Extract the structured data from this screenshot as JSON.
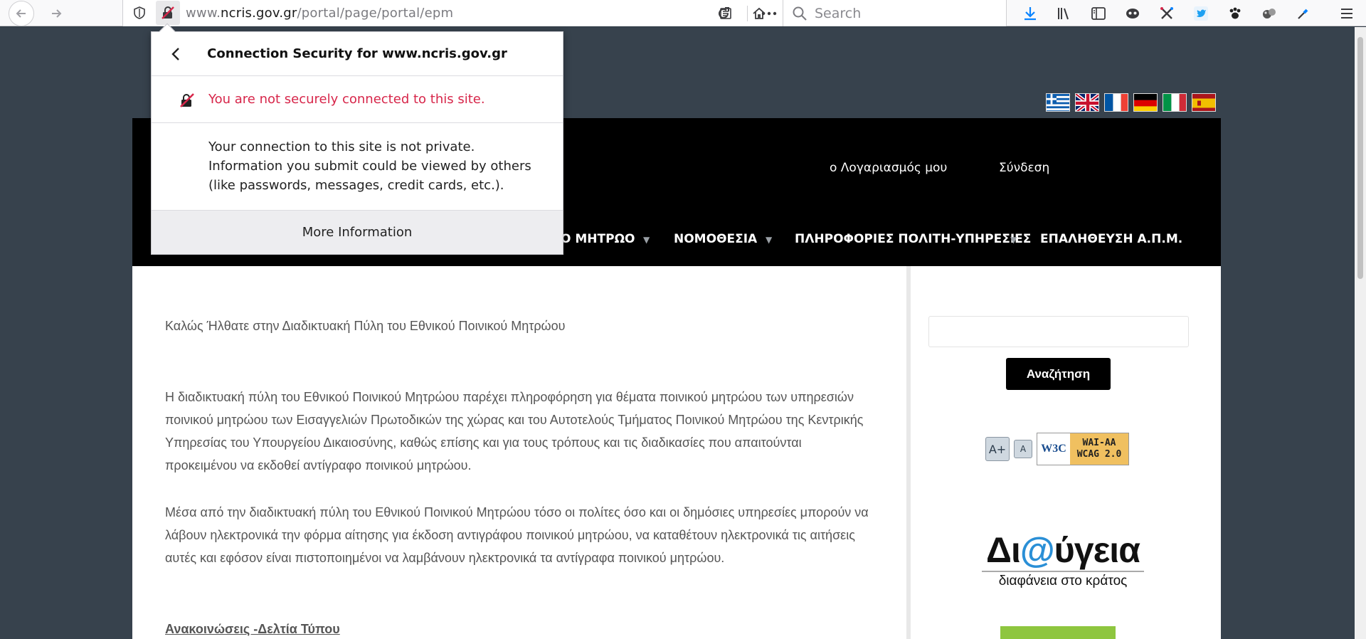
{
  "browser": {
    "url_prefix": "www.",
    "url_domain": "ncris.gov.gr",
    "url_path": "/portal/page/portal/epm",
    "search_placeholder": "Search",
    "icons": {
      "back": "back-arrow-icon",
      "forward": "forward-arrow-icon",
      "tracking": "tracking-shield-icon",
      "insecure": "insecure-lock-icon",
      "reader": "reader-view-icon",
      "more": "page-actions-icon",
      "pocket": "pocket-icon",
      "bookmark": "bookmark-star-icon",
      "reload": "reload-icon",
      "home": "home-icon",
      "search": "search-icon",
      "download": "download-arrow-icon",
      "library": "library-icon",
      "sidebar": "sidebar-icon",
      "menu": "hamburger-menu-icon"
    },
    "colors": {
      "download": "#0a84ff",
      "insecure": "#d7264a"
    }
  },
  "popup": {
    "title": "Connection Security for www.ncris.gov.gr",
    "warning": "You are not securely connected to this site.",
    "info": "Your connection to this site is not private. Information you submit could be viewed by others (like passwords, messages, credit cards, etc.).",
    "more_button": "More Information"
  },
  "site": {
    "header_links": {
      "account": "ο Λογαριασμός μου",
      "login": "Σύνδεση"
    },
    "nav": [
      {
        "label": "Ο ΜΗΤΡΩΟ"
      },
      {
        "label": "ΝΟΜΟΘΕΣΙΑ"
      },
      {
        "label": "ΠΛΗΡΟΦΟΡΙΕΣ ΠΟΛΙΤΗ-ΥΠΗΡΕΣΙΕΣ"
      },
      {
        "label": "ΕΠΑΛΗΘΕΥΣΗ Α.Π.Μ."
      }
    ],
    "flags": [
      "greek-flag-icon",
      "uk-flag-icon",
      "french-flag-icon",
      "german-flag-icon",
      "italian-flag-icon",
      "spanish-flag-icon"
    ],
    "welcome": "Καλώς Ήλθατε στην Διαδικτυακή Πύλη του Εθνικού Ποινικού Μητρώου",
    "para1": "Η διαδικτυακή πύλη του Εθνικού Ποινικού Μητρώου παρέχει πληροφόρηση για θέματα  ποινικού μητρώου των υπηρεσιών ποινικού μητρώου των Εισαγγελιών Πρωτοδικών της χώρας και του Αυτοτελούς Τμήματος Ποινικού Μητρώου της Κεντρικής Υπηρεσίας του Υπουργείου Δικαιοσύνης, καθώς επίσης και για τους τρόπους και τις διαδικασίες που απαιτούνται προκειμένου να εκδοθεί αντίγραφο ποινικού μητρώου.",
    "para2": "Μέσα από την διαδικτυακή πύλη του Εθνικού Ποινικού Μητρώου τόσο οι πολίτες όσο και οι δημόσιες υπηρεσίες μπορούν να λάβουν ηλεκτρονικά την φόρμα αίτησης για έκδοση αντιγράφου ποινικού μητρώου, να καταθέτουν ηλεκτρονικά τις αιτήσεις αυτές και εφόσον είναι πιστοποιημένοι να λαμβάνουν ηλεκτρονικά τα αντίγραφα ποινικού μητρώου.",
    "news_link": "Ανακοινώσεις -Δελτία Τύπου",
    "search_button": "Αναζήτηση",
    "a11y": {
      "increase": "A",
      "decrease": "A"
    },
    "w3c": {
      "logo": "W3C",
      "line1": "WAI-AA",
      "line2": "WCAG 2.0"
    },
    "diavgeia": {
      "part1": "Δι",
      "part2": "@",
      "part3": "ύγεια",
      "subtitle": "διαφάνεια στο κράτος"
    }
  }
}
